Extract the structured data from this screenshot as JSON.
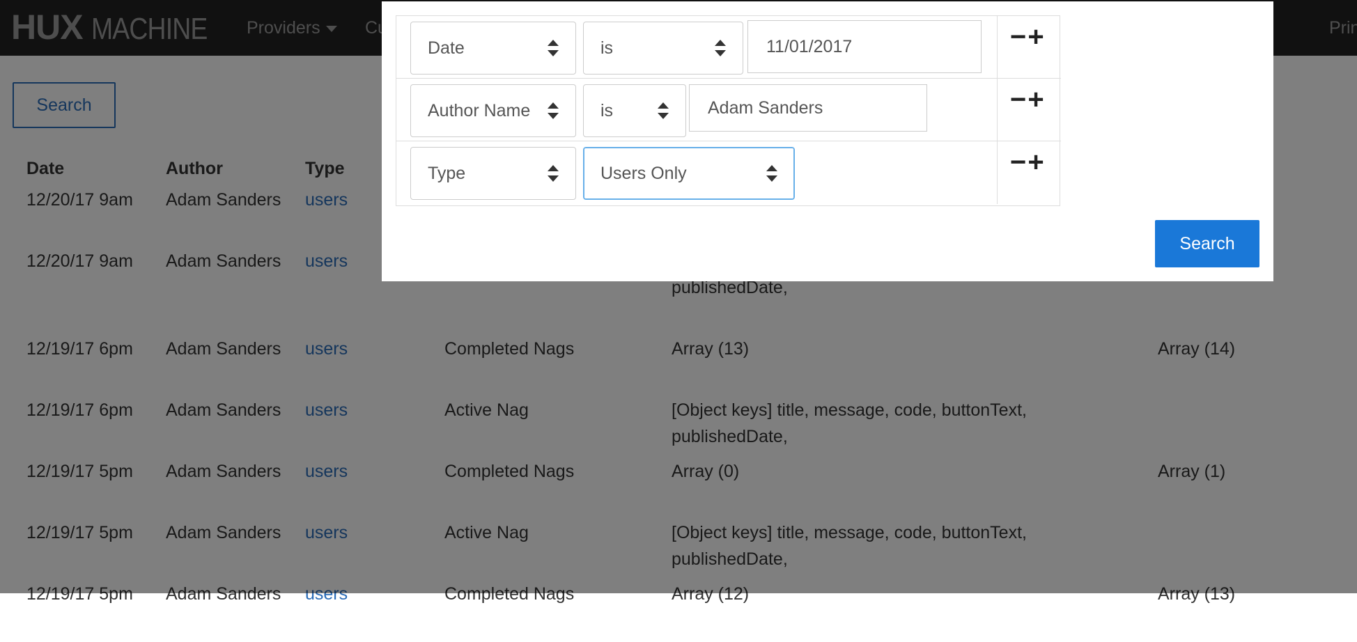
{
  "navbar": {
    "brand_bold": "HUX",
    "brand_rest": "MACHINE",
    "items": [
      "Providers",
      "Cu"
    ],
    "right_item": "Prin"
  },
  "page": {
    "search_label": "Search"
  },
  "table": {
    "headers": [
      "Date",
      "Author",
      "Type",
      "",
      "",
      ""
    ],
    "rows": [
      {
        "date": "12/20/17 9am",
        "author": "Adam Sanders",
        "type": "users",
        "field": "",
        "new": "",
        "old": ""
      },
      {
        "date": "12/20/17 9am",
        "author": "Adam Sanders",
        "type": "users",
        "field": "",
        "new": "publishedDate,",
        "old": ""
      },
      {
        "date": "12/19/17 6pm",
        "author": "Adam Sanders",
        "type": "users",
        "field": "Completed Nags",
        "new": "Array (13)",
        "old": "Array (14)"
      },
      {
        "date": "12/19/17 6pm",
        "author": "Adam Sanders",
        "type": "users",
        "field": "Active Nag",
        "new": "[Object keys] title, message, code, buttonText, publishedDate,",
        "old": ""
      },
      {
        "date": "12/19/17 5pm",
        "author": "Adam Sanders",
        "type": "users",
        "field": "Completed Nags",
        "new": "Array (0)",
        "old": "Array (1)"
      },
      {
        "date": "12/19/17 5pm",
        "author": "Adam Sanders",
        "type": "users",
        "field": "Active Nag",
        "new": "[Object keys] title, message, code, buttonText, publishedDate,",
        "old": ""
      },
      {
        "date": "12/19/17 5pm",
        "author": "Adam Sanders",
        "type": "users",
        "field": "Completed Nags",
        "new": "Array (12)",
        "old": "Array (13)"
      }
    ]
  },
  "modal": {
    "filters": [
      {
        "field": "Date",
        "operator": "is",
        "value": "11/01/2017"
      },
      {
        "field": "Author Name",
        "operator": "is",
        "value": "Adam Sanders"
      },
      {
        "field": "Type",
        "operator": "Users Only",
        "value": ""
      }
    ],
    "minus_symbol": "−",
    "plus_symbol": "+",
    "search_label": "Search"
  },
  "colors": {
    "navbar_bg": "#222222",
    "link": "#2a6cb8",
    "primary_button": "#1a78d8",
    "focus_border": "#66afe9"
  }
}
